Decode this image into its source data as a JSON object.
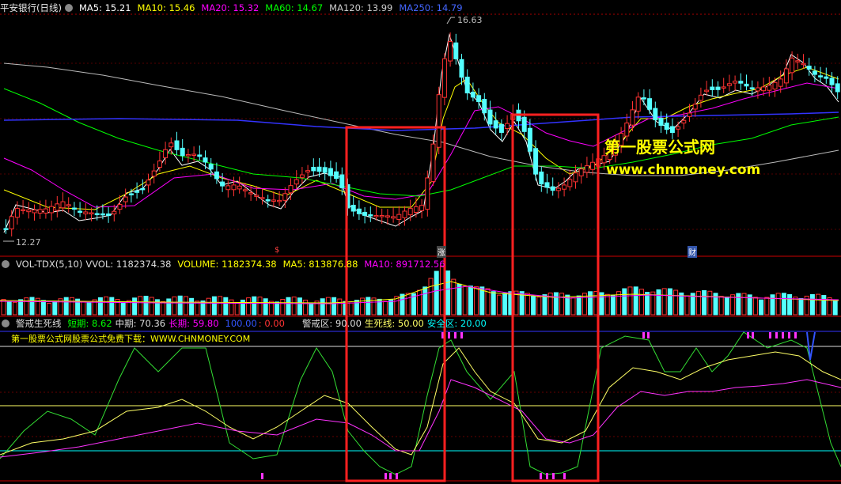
{
  "main_header": {
    "title": "平安银行(日线)",
    "ma5": "MA5: 15.21",
    "ma10": "MA10: 15.46",
    "ma20": "MA20: 15.32",
    "ma60": "MA60: 14.67",
    "ma120": "MA120: 13.99",
    "ma250": "MA250: 14.79"
  },
  "price_labels": {
    "high": "16.63",
    "low": "12.27"
  },
  "event_tags": {
    "tag1": "$",
    "tag2": "涨",
    "tag3": "财"
  },
  "vol_header": {
    "name": "VOL-TDX(5,10)",
    "vvol": "VVOL: 1182374.38",
    "volume": "VOLUME: 1182374.38",
    "ma5": "MA5: 813876.88",
    "ma10": "MA10: 891712.56"
  },
  "ind_header": {
    "name": "警戒生死线",
    "short": "短期: 8.62",
    "mid": "中期: 70.36",
    "long": "长期: 59.80",
    "l100": "100.00",
    "l0": ": 0.00",
    "warn": "警戒区: 90.00",
    "life": "生死线: 50.00",
    "safe": "安全区: 20.00"
  },
  "watermark": {
    "line1": "第一股票公式网",
    "line2": "www.chnmoney.com"
  },
  "indicator_caption": "第一股票公式网股票公式免费下载：WWW.CHNMONEY.COM",
  "colors": {
    "up": "#ff3232",
    "down": "#54ffff",
    "ma5": "#ffffff",
    "ma10": "#ffff00",
    "ma20": "#ff00ff",
    "ma60": "#00ff00",
    "ma120": "#bbbbbb",
    "ma250": "#3333ff",
    "highlight_box": "#ff2020"
  }
}
